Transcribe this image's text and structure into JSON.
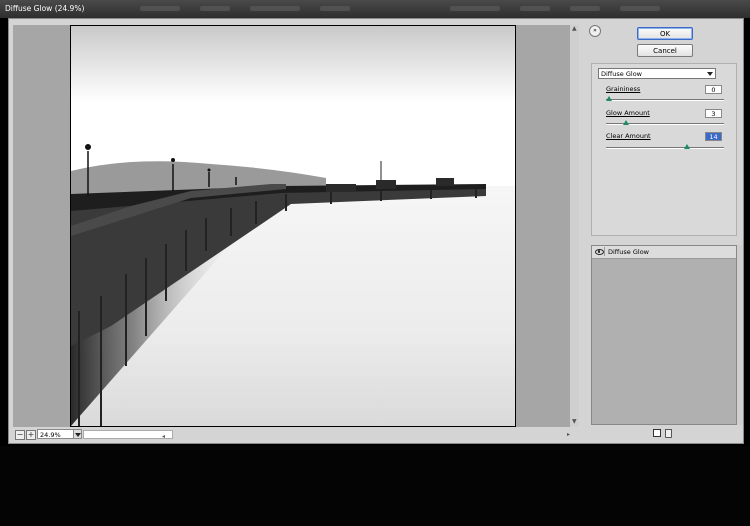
{
  "window": {
    "title": "Diffuse Glow (24.9%)"
  },
  "buttons": {
    "ok": "OK",
    "cancel": "Cancel"
  },
  "filter": {
    "selected": "Diffuse Glow"
  },
  "params": [
    {
      "label": "Graininess",
      "value": "0",
      "fraction": 0.0
    },
    {
      "label": "Glow Amount",
      "value": "3",
      "fraction": 0.15
    },
    {
      "label": "Clear Amount",
      "value": "14",
      "fraction": 0.7
    }
  ],
  "layers": [
    {
      "name": "Diffuse Glow"
    }
  ],
  "status": {
    "zoom": "24.9%",
    "zoom_out": "−",
    "zoom_in": "+"
  },
  "icons": {
    "collapse": "double-chevron-up-icon",
    "eye": "eye-icon",
    "new_layer": "new-layer-icon",
    "delete": "trash-icon"
  },
  "colors": {
    "accent": "#3a6bc9",
    "slider_thumb": "#1f8a6b"
  }
}
